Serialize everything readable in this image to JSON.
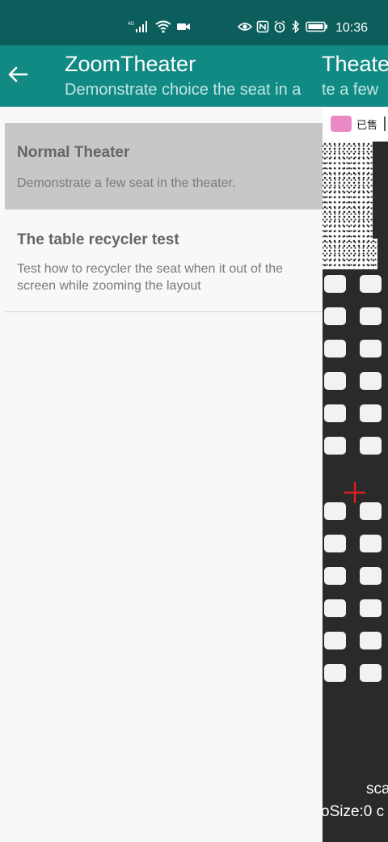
{
  "status_bar": {
    "network": "4G",
    "time": "10:36",
    "icons": [
      "signal-icon",
      "wifi-icon",
      "video-icon",
      "eye-icon",
      "nfc-icon",
      "alarm-icon",
      "bluetooth-icon",
      "battery-icon"
    ]
  },
  "app_bar": {
    "title": "ZoomTheater",
    "subtitle": "Demonstrate choice the seat in a",
    "back_icon": "arrow-left-icon"
  },
  "list": {
    "items": [
      {
        "title": "Normal Theater",
        "description": "Demonstrate a few seat in the theater."
      },
      {
        "title": "The table recycler test",
        "description": "Test how to recycler the seat when it out of the screen while zooming the layout"
      }
    ]
  },
  "background_screen": {
    "title_fragment": "Theater",
    "subtitle_fragment": "te a few",
    "legend_label": "已售",
    "footer_line_1": "sca",
    "footer_line_2": "oSize:0 c"
  },
  "colors": {
    "status_bar": "#0b5e5b",
    "app_bar": "#128a84",
    "selected_item": "#c7c7c7",
    "seat_panel": "#2a2a2a",
    "seat": "#f2f2f2",
    "legend_sold": "#e98ac4",
    "crosshair": "#e02020"
  }
}
